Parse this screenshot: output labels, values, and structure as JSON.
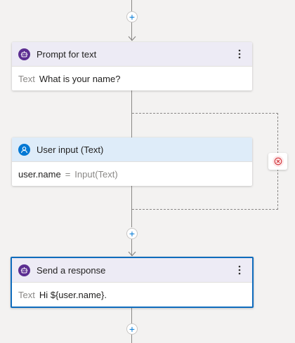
{
  "flow": {
    "add_label": "+",
    "nodes": [
      {
        "title": "Prompt for text",
        "icon": "bot-icon",
        "body_label": "Text",
        "body_value": "What is your name?"
      },
      {
        "title": "User input (Text)",
        "icon": "user-icon",
        "body_var": "user.name",
        "body_op": "=",
        "body_value": "Input(Text)"
      },
      {
        "title": "Send a response",
        "icon": "bot-icon",
        "body_label": "Text",
        "body_value": "Hi ${user.name}.",
        "selected": true
      }
    ],
    "error_icon": "error-circle-icon"
  },
  "colors": {
    "accent": "#0078d4",
    "purple": "#5c2e91",
    "error": "#d13438"
  }
}
